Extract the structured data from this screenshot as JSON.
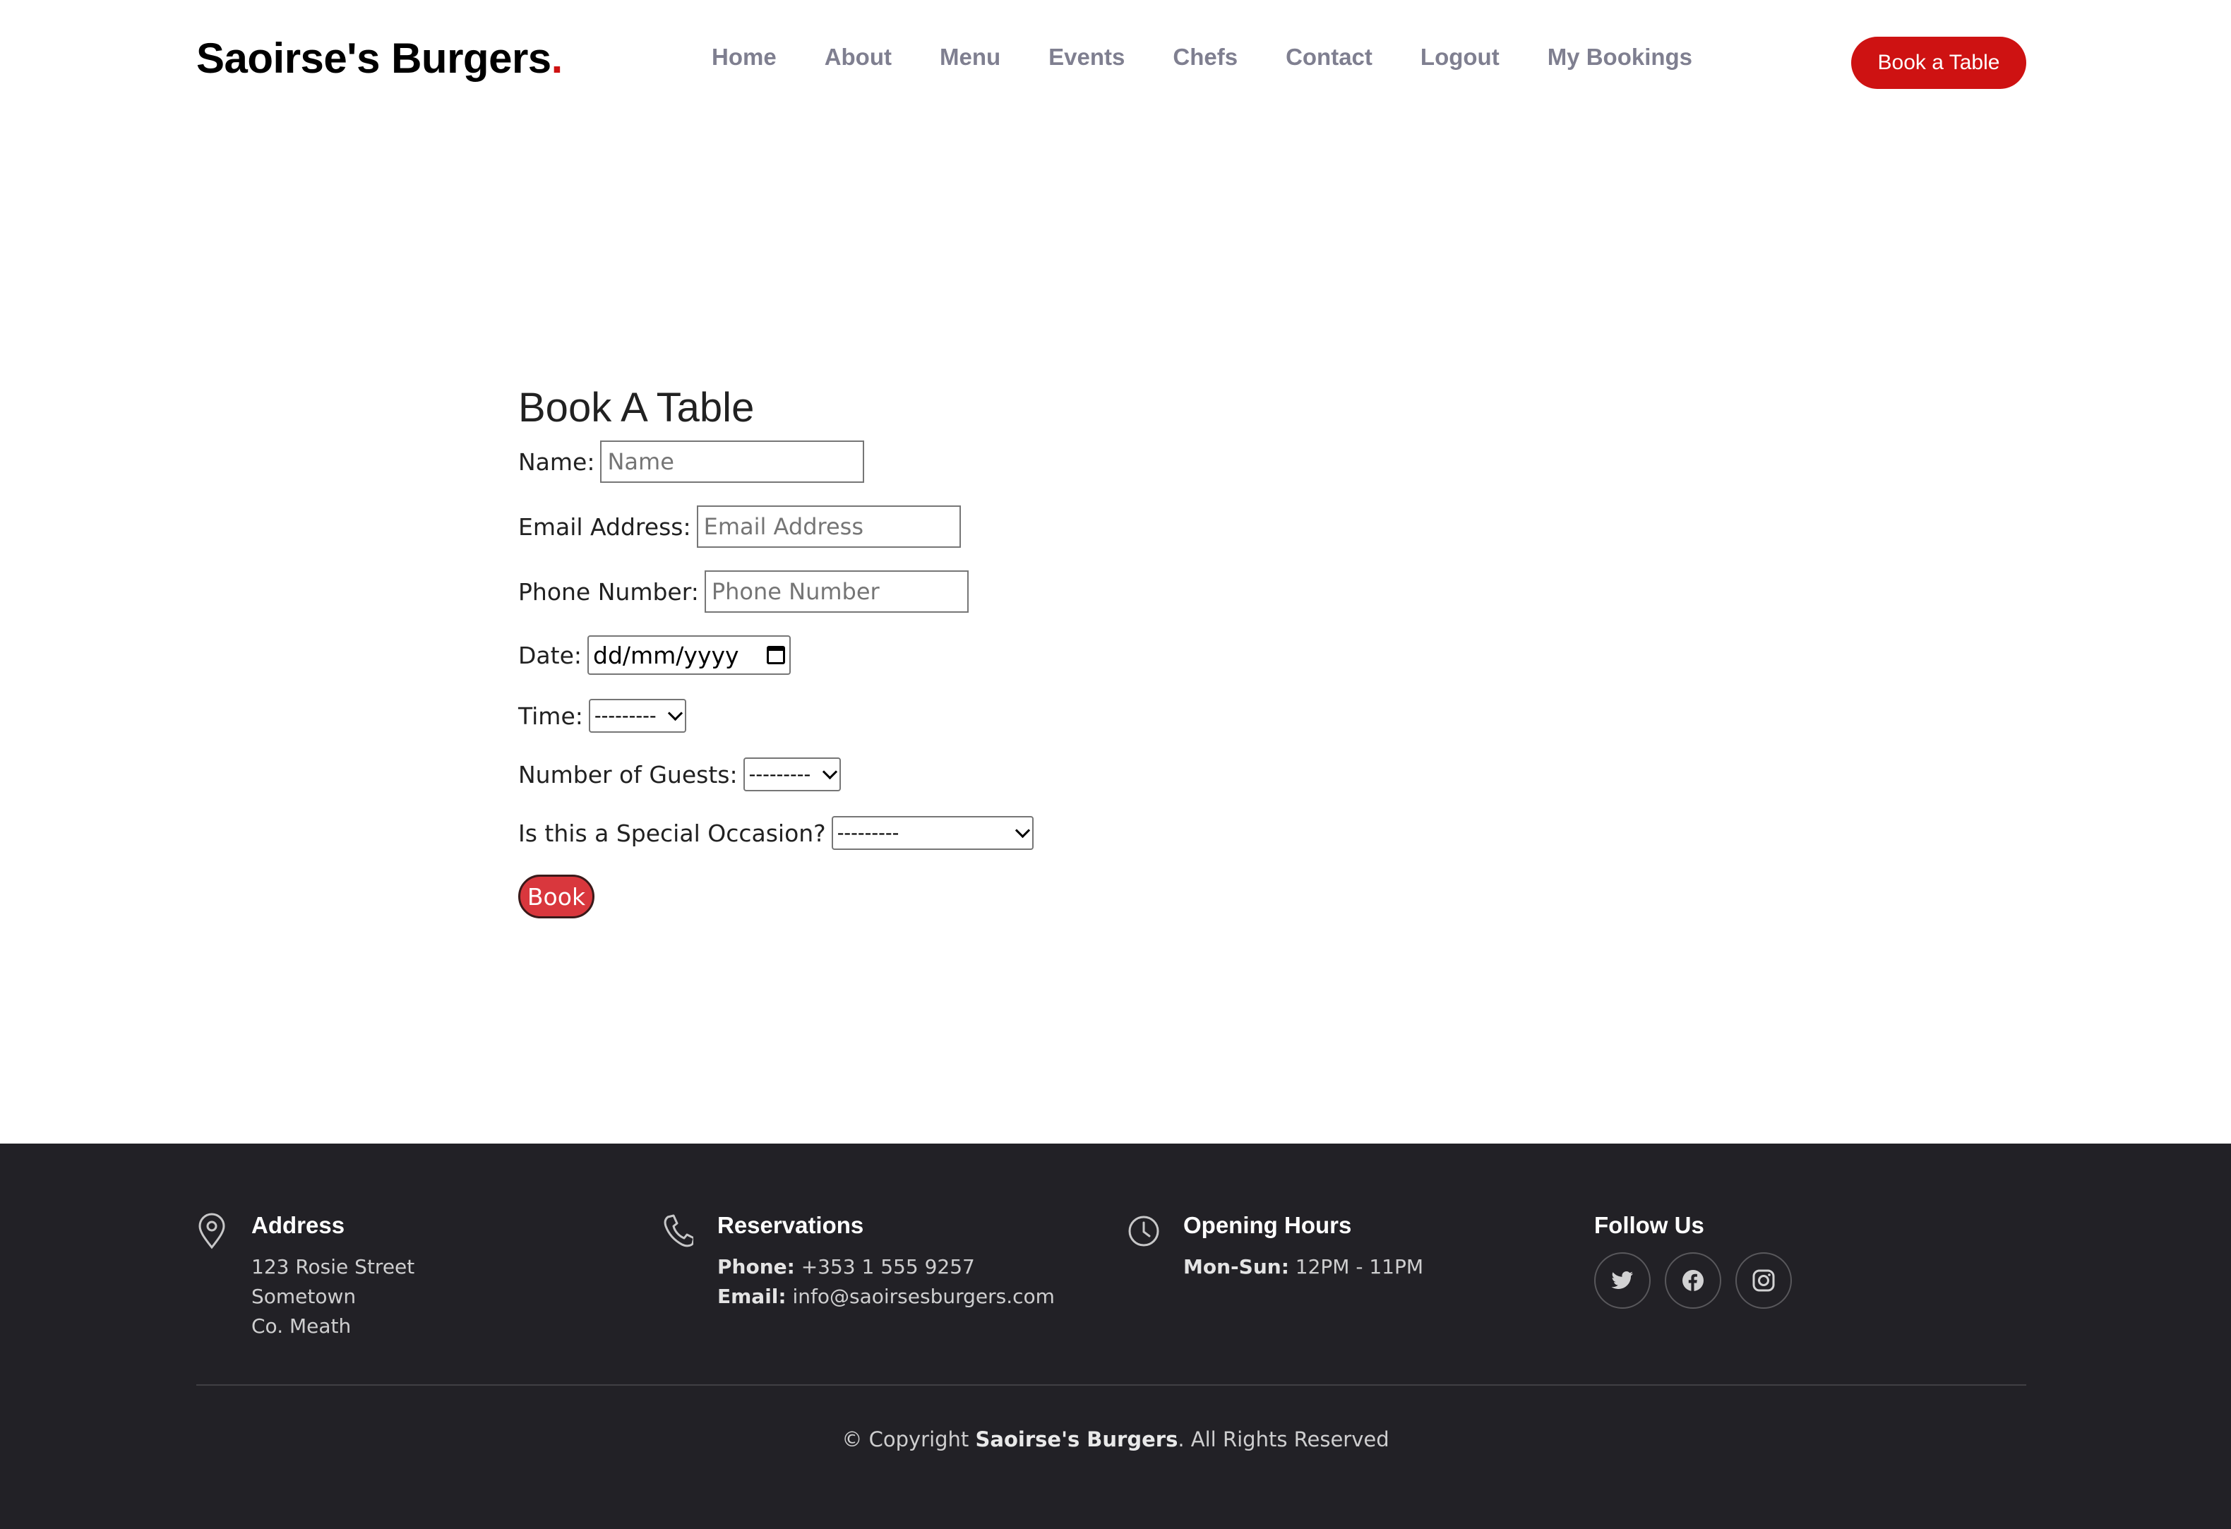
{
  "header": {
    "logo_text": "Saoirse's Burgers",
    "logo_dot": ".",
    "nav": [
      "Home",
      "About",
      "Menu",
      "Events",
      "Chefs",
      "Contact",
      "Logout",
      "My Bookings"
    ],
    "cta_label": "Book a Table"
  },
  "form": {
    "title": "Book A Table",
    "name_label": "Name:",
    "name_placeholder": "Name",
    "email_label": "Email Address:",
    "email_placeholder": "Email Address",
    "phone_label": "Phone Number:",
    "phone_placeholder": "Phone Number",
    "date_label": "Date:",
    "date_value": "dd/mm/yyyy",
    "time_label": "Time:",
    "time_value": "---------",
    "guests_label": "Number of Guests:",
    "guests_value": "---------",
    "occasion_label": "Is this a Special Occasion?",
    "occasion_value": "---------",
    "submit_label": "Book"
  },
  "footer": {
    "address": {
      "heading": "Address",
      "lines": [
        "123 Rosie Street",
        "Sometown",
        "Co. Meath"
      ],
      "icon": "map-pin-icon"
    },
    "reservations": {
      "heading": "Reservations",
      "phone_label": "Phone:",
      "phone_value": " +353 1 555 9257",
      "email_label": "Email:",
      "email_value": " info@saoirsesburgers.com",
      "icon": "phone-icon"
    },
    "hours": {
      "heading": "Opening Hours",
      "days_label": "Mon-Sun:",
      "days_value": " 12PM - 11PM",
      "icon": "clock-icon"
    },
    "follow": {
      "heading": "Follow Us",
      "icons": [
        "twitter-icon",
        "facebook-icon",
        "instagram-icon"
      ]
    },
    "copyright_prefix": "© Copyright ",
    "copyright_brand": "Saoirse's Burgers",
    "copyright_suffix": ". All Rights Reserved"
  },
  "colors": {
    "accent": "#ce1212",
    "footer_bg": "#222126",
    "nav_text": "#7f7f90"
  }
}
